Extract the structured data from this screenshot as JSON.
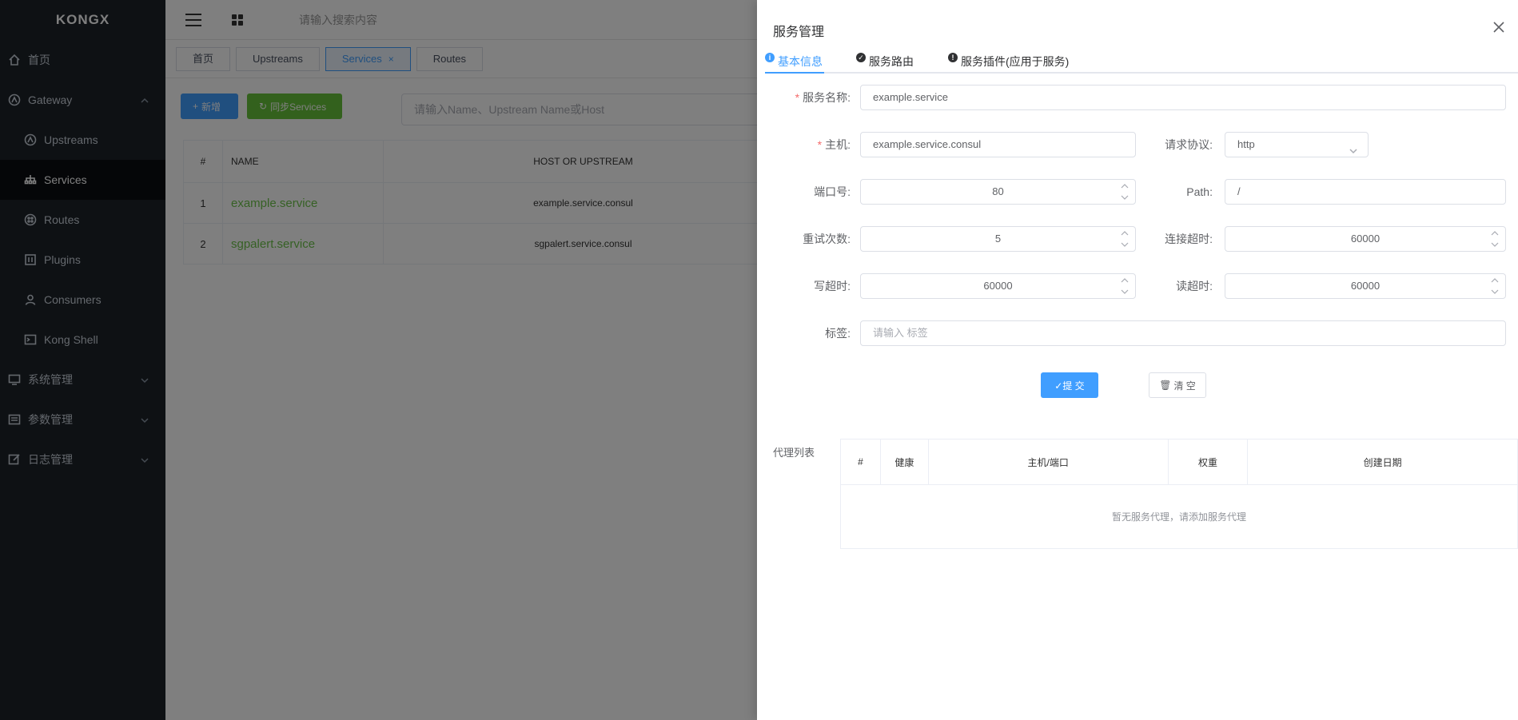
{
  "app": {
    "logo": "KONGX"
  },
  "sidebar": {
    "items": [
      {
        "label": "首页"
      },
      {
        "label": "Gateway"
      },
      {
        "label": "Upstreams"
      },
      {
        "label": "Services"
      },
      {
        "label": "Routes"
      },
      {
        "label": "Plugins"
      },
      {
        "label": "Consumers"
      },
      {
        "label": "Kong Shell"
      },
      {
        "label": "系统管理"
      },
      {
        "label": "参数管理"
      },
      {
        "label": "日志管理"
      }
    ]
  },
  "topbar": {
    "search_placeholder": "请输入搜索内容"
  },
  "tabs": [
    {
      "label": "首页"
    },
    {
      "label": "Upstreams"
    },
    {
      "label": "Services",
      "close": "×"
    },
    {
      "label": "Routes"
    }
  ],
  "toolbar": {
    "add_label": "新增",
    "sync_label": "同步Services",
    "filter_placeholder": "请输入Name、Upstream Name或Host"
  },
  "services_table": {
    "headers": [
      "#",
      "NAME",
      "HOST OR UPSTREAM"
    ],
    "rows": [
      {
        "index": "1",
        "name": "example.service",
        "host": "example.service.consul"
      },
      {
        "index": "2",
        "name": "sgpalert.service",
        "host": "sgpalert.service.consul"
      }
    ]
  },
  "drawer": {
    "title": "服务管理",
    "tabs": [
      {
        "label": "基本信息",
        "icon": "i"
      },
      {
        "label": "服务路由",
        "icon": "✓"
      },
      {
        "label": "服务插件(应用于服务)",
        "icon": "!"
      }
    ],
    "form": {
      "name_label": "服务名称:",
      "name_value": "example.service",
      "host_label": "主机:",
      "host_value": "example.service.consul",
      "protocol_label": "请求协议:",
      "protocol_value": "http",
      "port_label": "端口号:",
      "port_value": "80",
      "path_label": "Path:",
      "path_value": "/",
      "retries_label": "重试次数:",
      "retries_value": "5",
      "connect_timeout_label": "连接超时:",
      "connect_timeout_value": "60000",
      "write_timeout_label": "写超时:",
      "write_timeout_value": "60000",
      "read_timeout_label": "读超时:",
      "read_timeout_value": "60000",
      "tags_label": "标签:",
      "tags_placeholder": "请输入 标签",
      "required_mark": "*"
    },
    "submit_label": "✓提 交",
    "clear_label": "清 空",
    "proxy_label": "代理列表",
    "proxy_table": {
      "headers": [
        "#",
        "健康",
        "主机/端口",
        "权重",
        "创建日期"
      ],
      "empty_text": "暂无服务代理，请添加服务代理"
    }
  }
}
